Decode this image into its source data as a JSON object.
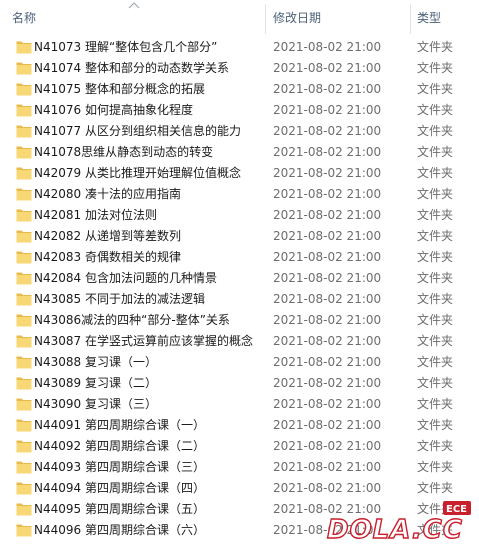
{
  "header": {
    "name_label": "名称",
    "date_label": "修改日期",
    "type_label": "类型"
  },
  "files": [
    {
      "name": "N41073 理解“整体包含几个部分”",
      "date": "2021-08-02 21:00",
      "type": "文件夹"
    },
    {
      "name": "N41074 整体和部分的动态数学关系",
      "date": "2021-08-02 21:00",
      "type": "文件夹"
    },
    {
      "name": "N41075 整体和部分概念的拓展",
      "date": "2021-08-02 21:00",
      "type": "文件夹"
    },
    {
      "name": "N41076 如何提高抽象化程度",
      "date": "2021-08-02 21:00",
      "type": "文件夹"
    },
    {
      "name": "N41077 从区分到组织相关信息的能力",
      "date": "2021-08-02 21:00",
      "type": "文件夹"
    },
    {
      "name": "N41078思维从静态到动态的转变",
      "date": "2021-08-02 21:00",
      "type": "文件夹"
    },
    {
      "name": "N42079 从类比推理开始理解位值概念",
      "date": "2021-08-02 21:00",
      "type": "文件夹"
    },
    {
      "name": "N42080 凑十法的应用指南",
      "date": "2021-08-02 21:00",
      "type": "文件夹"
    },
    {
      "name": "N42081 加法对位法则",
      "date": "2021-08-02 21:00",
      "type": "文件夹"
    },
    {
      "name": "N42082  从递增到等差数列",
      "date": "2021-08-02 21:00",
      "type": "文件夹"
    },
    {
      "name": "N42083 奇偶数相关的规律",
      "date": "2021-08-02 21:00",
      "type": "文件夹"
    },
    {
      "name": "N42084  包含加法问题的几种情景",
      "date": "2021-08-02 21:00",
      "type": "文件夹"
    },
    {
      "name": "N43085  不同于加法的减法逻辑",
      "date": "2021-08-02 21:00",
      "type": "文件夹"
    },
    {
      "name": "N43086减法的四种“部分-整体”关系",
      "date": "2021-08-02 21:00",
      "type": "文件夹"
    },
    {
      "name": "N43087 在学竖式运算前应该掌握的概念",
      "date": "2021-08-02 21:00",
      "type": "文件夹"
    },
    {
      "name": "N43088 复习课（一）",
      "date": "2021-08-02 21:00",
      "type": "文件夹"
    },
    {
      "name": "N43089 复习课（二）",
      "date": "2021-08-02 21:00",
      "type": "文件夹"
    },
    {
      "name": "N43090 复习课（三）",
      "date": "2021-08-02 21:00",
      "type": "文件夹"
    },
    {
      "name": "N44091 第四周期综合课（一）",
      "date": "2021-08-02 21:00",
      "type": "文件夹"
    },
    {
      "name": "N44092  第四周期综合课（二）",
      "date": "2021-08-02 21:00",
      "type": "文件夹"
    },
    {
      "name": "N44093  第四周期综合课（三）",
      "date": "2021-08-02 21:00",
      "type": "文件夹"
    },
    {
      "name": "N44094  第四周期综合课（四）",
      "date": "2021-08-02 21:00",
      "type": "文件夹"
    },
    {
      "name": "N44095 第四周期综合课（五）",
      "date": "2021-08-02 21:00",
      "type": "文件夹"
    },
    {
      "name": "N44096 第四周期综合课（六）",
      "date": "2021-08-02 21:00",
      "type": "文件夹"
    }
  ],
  "icons": {
    "folder": "folder-icon",
    "sort": "sort-up-icon"
  },
  "colors": {
    "folder_fill": "#f8d775",
    "folder_tab": "#e9b949",
    "header_text": "#4c607a",
    "watermark_red": "#c8202c"
  },
  "watermark": {
    "text": "DOLA.CC",
    "badge": "ECE"
  }
}
